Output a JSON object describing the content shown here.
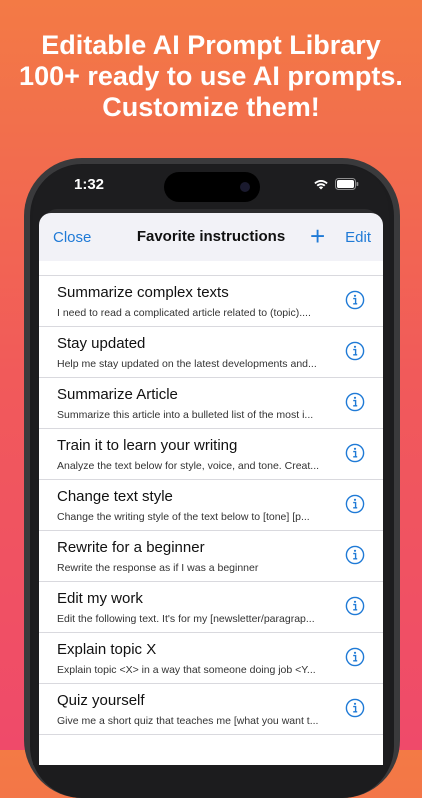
{
  "headline": {
    "line1": "Editable AI Prompt Library",
    "line2": "100+ ready to use AI prompts.",
    "line3": "Customize them!"
  },
  "status": {
    "time": "1:32"
  },
  "nav": {
    "close_label": "Close",
    "title": "Favorite instructions",
    "add_label": "+",
    "edit_label": "Edit"
  },
  "colors": {
    "accent": "#1f7ad6",
    "background_top": "#f37a45",
    "background_bottom": "#ef4a6a"
  },
  "items": [
    {
      "title": "Summarize complex texts",
      "subtitle": "I need to read a complicated article related to (topic)...."
    },
    {
      "title": "Stay updated",
      "subtitle": "Help me stay updated on the latest developments and..."
    },
    {
      "title": "Summarize Article",
      "subtitle": "Summarize this article into a bulleted list of the most i..."
    },
    {
      "title": "Train it to learn your writing",
      "subtitle": "Analyze the text below for style, voice, and tone. Creat..."
    },
    {
      "title": " Change text style",
      "subtitle": "Change the writing style of the text below to [tone] [p..."
    },
    {
      "title": "Rewrite for a beginner",
      "subtitle": "Rewrite the response as if I was a beginner"
    },
    {
      "title": "Edit my work",
      "subtitle": "Edit the following text. It's for my [newsletter/paragrap..."
    },
    {
      "title": "Explain topic X",
      "subtitle": "Explain topic <X> in a way that someone doing job <Y..."
    },
    {
      "title": "Quiz yourself",
      "subtitle": "Give me a short quiz that teaches me [what you want t..."
    }
  ]
}
